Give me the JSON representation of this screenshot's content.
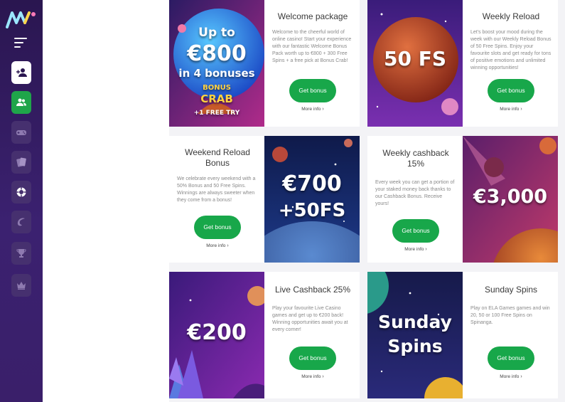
{
  "sidebar": {
    "icons": [
      "logo",
      "menu-icon",
      "user-add-icon",
      "users-icon",
      "gamepad-icon",
      "cards-icon",
      "chip-icon",
      "sports-icon",
      "trophy-icon",
      "crown-icon"
    ]
  },
  "colors": {
    "accent": "#18a74a",
    "sidebar": "#2a1650"
  },
  "promos": [
    {
      "title": "Welcome package",
      "description": "Welcome to the cheerful world of online casino! Start your experience with our fantastic Welcome Bonus Pack worth up to €800 + 300 Free Spins + a free pick at Bonus Crab!",
      "button": "Get bonus",
      "more": "More info",
      "art_lines": [
        "Up to",
        "€800",
        "in 4 bonuses"
      ],
      "art_badge": [
        "BONUS",
        "CRAB",
        "+1 FREE TRY"
      ]
    },
    {
      "title": "Weekly Reload",
      "description": "Let's boost your mood during the week with our Weekly Reload Bonus of 50 Free Spins. Enjoy your favourite slots and get ready for tons of positive emotions and unlimited winning opportunities!",
      "button": "Get bonus",
      "more": "More info",
      "art_text": "50 FS"
    },
    {
      "title": "Weekend Reload Bonus",
      "description": "We celebrate every weekend with a 50% Bonus and 50 Free Spins. Winnings are always sweeter when they come from a bonus!",
      "button": "Get bonus",
      "more": "More info",
      "art_lines": [
        "€700",
        "+50FS"
      ]
    },
    {
      "title": "Weekly cashback 15%",
      "description": "Every week you can get a portion of your staked money back thanks to our Cashback Bonus. Receive yours!",
      "button": "Get bonus",
      "more": "More info",
      "art_text": "€3,000"
    },
    {
      "title": "Live Cashback 25%",
      "description": "Play your favourite Live Casino games and get up to €200 back! Winning opportunities await you at every corner!",
      "button": "Get bonus",
      "more": "More info",
      "art_text": "€200"
    },
    {
      "title": "Sunday Spins",
      "description": "Play on ELA Games games and win 20, 50 or 100 Free Spins on Spinanga.",
      "button": "Get bonus",
      "more": "More info",
      "art_lines": [
        "Sunday",
        "Spins"
      ]
    }
  ]
}
